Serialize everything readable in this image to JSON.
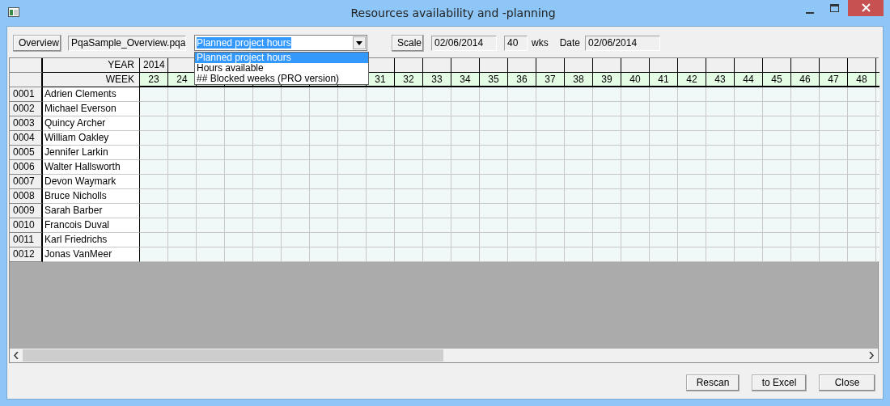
{
  "window": {
    "title": "Resources availability and -planning"
  },
  "toolbar": {
    "overview_button": "Overview",
    "file": "PqaSample_Overview.pqa",
    "view_select": {
      "value": "Planned project hours",
      "expanded": true,
      "options": [
        {
          "label": "Planned project hours",
          "selected": true
        },
        {
          "label": "Hours available",
          "selected": false
        },
        {
          "label": "## Blocked weeks  (PRO version)",
          "selected": false
        }
      ]
    },
    "scale_button": "Scale",
    "start_date": "02/06/2014",
    "weeks": "40",
    "weeks_unit": "wks",
    "date_label": "Date",
    "date": "02/06/2014"
  },
  "grid": {
    "year_label": "YEAR",
    "week_label": "WEEK",
    "year": "2014",
    "weeks": [
      "23",
      "24"
    ],
    "weeks_after_dropdown": [
      "31",
      "32",
      "33",
      "34",
      "35",
      "36",
      "37",
      "38",
      "39",
      "40",
      "41",
      "42",
      "43",
      "44",
      "45",
      "46",
      "47",
      "48"
    ],
    "rows": [
      {
        "id": "0001",
        "name": "Adrien Clements"
      },
      {
        "id": "0002",
        "name": "Michael Everson"
      },
      {
        "id": "0003",
        "name": "Quincy Archer"
      },
      {
        "id": "0004",
        "name": "William Oakley"
      },
      {
        "id": "0005",
        "name": "Jennifer Larkin"
      },
      {
        "id": "0006",
        "name": "Walter Hallsworth"
      },
      {
        "id": "0007",
        "name": "Devon Waymark"
      },
      {
        "id": "0008",
        "name": "Bruce Nicholls"
      },
      {
        "id": "0009",
        "name": "Sarah Barber"
      },
      {
        "id": "0010",
        "name": "Francois Duval"
      },
      {
        "id": "0011",
        "name": "Karl Friedrichs"
      },
      {
        "id": "0012",
        "name": "Jonas VanMeer"
      }
    ]
  },
  "buttons": [
    "Rescan",
    "to Excel",
    "Close"
  ]
}
